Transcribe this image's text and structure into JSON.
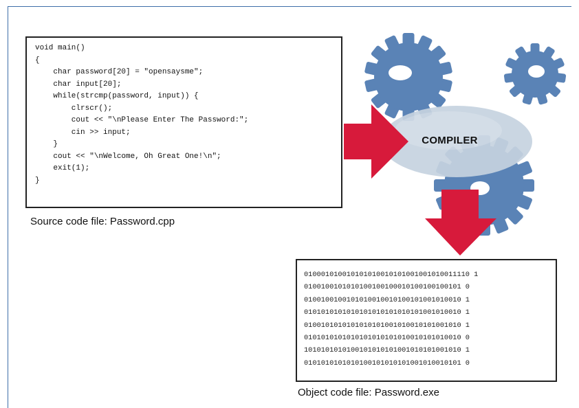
{
  "source_code": {
    "lines": [
      "void main()",
      "{",
      "    char password[20] = \"opensaysme\";",
      "    char input[20];",
      "    while(strcmp(password, input)) {",
      "        clrscr();",
      "        cout << \"\\nPlease Enter The Password:\";",
      "        cin >> input;",
      "    }",
      "    cout << \"\\nWelcome, Oh Great One!\\n\";",
      "    exit(1);",
      "}"
    ]
  },
  "source_caption": "Source code file: Password.cpp",
  "compiler_label": "COMPILER",
  "object_code": {
    "lines": [
      "010001010010101010010101001001010011110 1",
      "0100100101010100100100010100100100101 0",
      "0100100100101010010010100101001010010 1",
      "0101010101010101010101010101001010010 1",
      "0100101010101010101001010010101001010 1",
      "0101010101010101010101010010101010010 0",
      "1010101010100101010101001010101001010 1",
      "0101010101010100101010101001010010101 0"
    ]
  },
  "object_caption": "Object code file: Password.exe",
  "colors": {
    "gear": "#5a83b6",
    "gear_dark": "#4a6f9e",
    "compiler_oval": "#c5d2e0",
    "arrow": "#d71a3b",
    "frame": "#3d6ea8"
  }
}
